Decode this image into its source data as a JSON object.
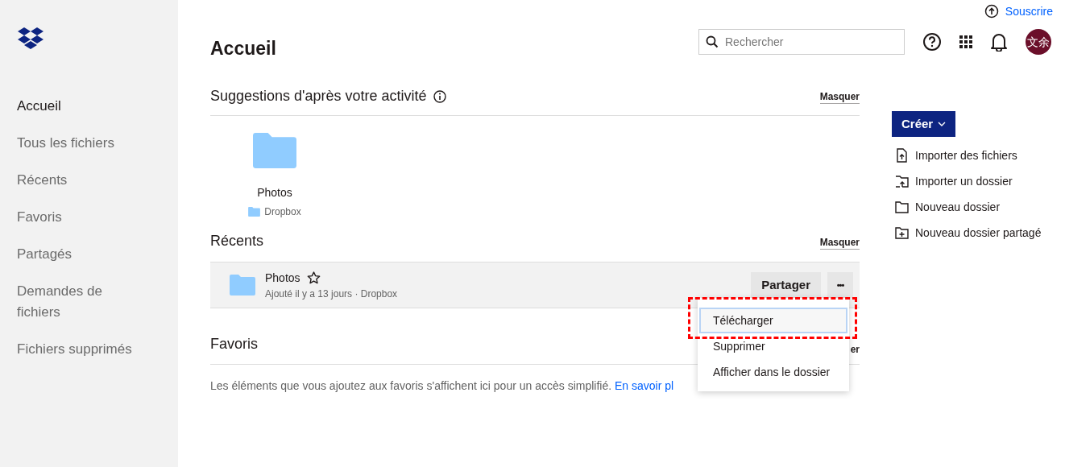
{
  "sidebar": {
    "items": [
      {
        "label": "Accueil",
        "selected": true
      },
      {
        "label": "Tous les fichiers",
        "selected": false
      },
      {
        "label": "Récents",
        "selected": false
      },
      {
        "label": "Favoris",
        "selected": false
      },
      {
        "label": "Partagés",
        "selected": false
      },
      {
        "label": "Demandes de fichiers",
        "selected": false
      },
      {
        "label": "Fichiers supprimés",
        "selected": false
      }
    ]
  },
  "topbar": {
    "upgrade_link": "Souscrire",
    "search": {
      "placeholder": "Rechercher"
    },
    "avatar": "文余"
  },
  "page_title": "Accueil",
  "suggestions": {
    "title": "Suggestions d'après votre activité",
    "hide": "Masquer",
    "items": [
      {
        "name": "Photos",
        "location": "Dropbox"
      }
    ]
  },
  "recents": {
    "title": "Récents",
    "hide": "Masquer",
    "rows": [
      {
        "name": "Photos",
        "starred": false,
        "meta": "Ajouté il y a 13 jours · Dropbox",
        "share": "Partager",
        "more": "•••"
      }
    ]
  },
  "favorites": {
    "title": "Favoris",
    "hide_visible": "er",
    "text": "Les éléments que vous ajoutez aux favoris s'affichent ici pour un accès simplifié.",
    "link": "En savoir pl"
  },
  "context_menu": {
    "items": [
      {
        "label": "Télécharger",
        "highlighted": true
      },
      {
        "label": "Supprimer",
        "highlighted": false
      },
      {
        "label": "Afficher dans le dossier",
        "highlighted": false
      }
    ]
  },
  "create": {
    "button": "Créer",
    "actions": [
      {
        "kind": "upload-file",
        "label": "Importer des fichiers"
      },
      {
        "kind": "upload-folder",
        "label": "Importer un dossier"
      },
      {
        "kind": "new-folder",
        "label": "Nouveau dossier"
      },
      {
        "kind": "shared-folder",
        "label": "Nouveau dossier partagé"
      }
    ]
  }
}
